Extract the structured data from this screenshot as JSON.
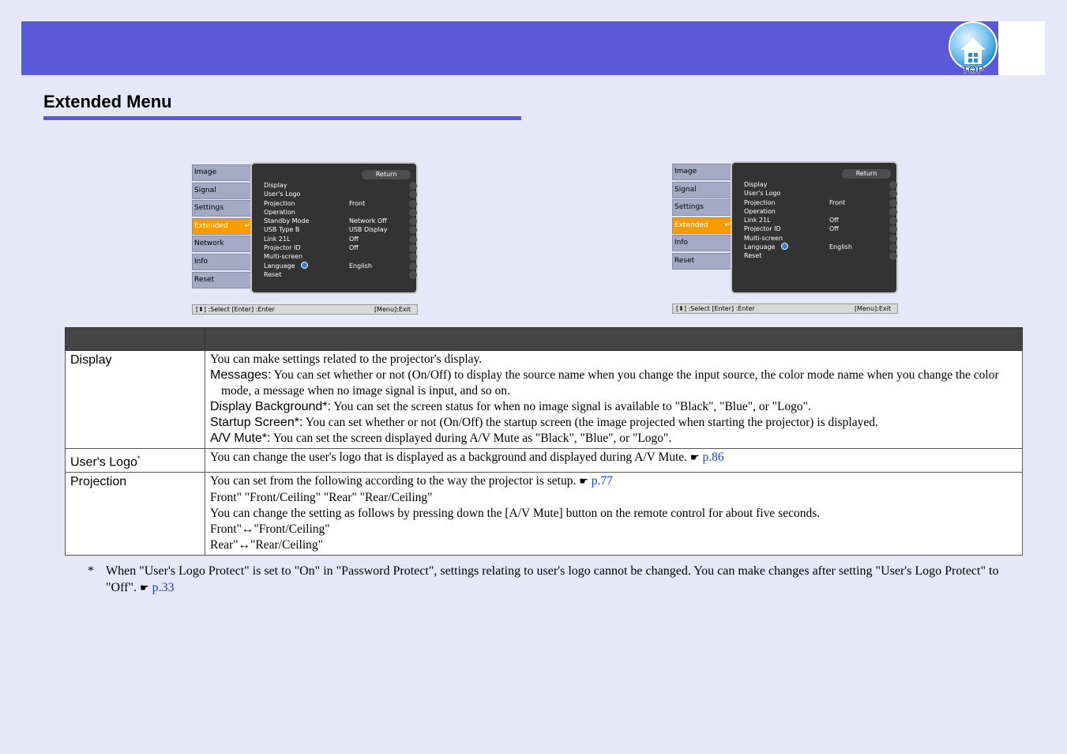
{
  "header": {
    "top_button_label": "TOP"
  },
  "page_title": "Extended Menu",
  "osd_left": {
    "tabs": [
      "Image",
      "Signal",
      "Settings",
      "Extended",
      "Network",
      "Info",
      "Reset"
    ],
    "active_tab": "Extended",
    "return_label": "Return",
    "rows": [
      {
        "label": "Display",
        "value": ""
      },
      {
        "label": "User's Logo",
        "value": ""
      },
      {
        "label": "Projection",
        "value": "Front"
      },
      {
        "label": "Operation",
        "value": ""
      },
      {
        "label": "Standby Mode",
        "value": "Network Off"
      },
      {
        "label": "USB Type B",
        "value": "USB Display"
      },
      {
        "label": "Link 21L",
        "value": "Off"
      },
      {
        "label": "Projector ID",
        "value": "Off"
      },
      {
        "label": "Multi-screen",
        "value": ""
      },
      {
        "label": "Language",
        "value": "English"
      },
      {
        "label": "Reset",
        "value": ""
      }
    ],
    "status_left": "[⬍] :Select  [Enter] :Enter",
    "status_right": "[Menu]:Exit"
  },
  "osd_right": {
    "tabs": [
      "Image",
      "Signal",
      "Settings",
      "Extended",
      "Info",
      "Reset"
    ],
    "active_tab": "Extended",
    "return_label": "Return",
    "rows": [
      {
        "label": "Display",
        "value": ""
      },
      {
        "label": "User's Logo",
        "value": ""
      },
      {
        "label": "Projection",
        "value": "Front"
      },
      {
        "label": "Operation",
        "value": ""
      },
      {
        "label": "Link 21L",
        "value": "Off"
      },
      {
        "label": "Projector ID",
        "value": "Off"
      },
      {
        "label": "Multi-screen",
        "value": ""
      },
      {
        "label": "Language",
        "value": "English"
      },
      {
        "label": "Reset",
        "value": ""
      }
    ],
    "status_left": "[⬍] :Select  [Enter] :Enter",
    "status_right": "[Menu]:Exit"
  },
  "table": {
    "display": {
      "name": "Display",
      "line1": "You can make settings related to the projector's display.",
      "messages_label": "Messages:",
      "messages_text": " You can set whether or not (On/Off) to display the source name when you change the input source, the color mode name when you change the color mode, a message when no image signal is input, and so on.",
      "background_label": "Display Background*:",
      "background_text": " You can set the screen status for when no image signal is available to \"Black\", \"Blue\", or \"Logo\".",
      "startup_label": "Startup Screen*:",
      "startup_text": " You can set whether or not (On/Off) the startup screen (the image projected when starting the projector) is displayed.",
      "avmute_label": "A/V Mute*:",
      "avmute_text": " You can set the screen displayed during A/V Mute as \"Black\", \"Blue\", or \"Logo\"."
    },
    "users_logo": {
      "name": "User's Logo",
      "sup": "*",
      "text": "You can change the user's logo that is displayed as a background and displayed during A/V Mute. ",
      "link": "p.86"
    },
    "projection": {
      "name": "Projection",
      "line1": "You can set from the following according to the way the projector is setup. ",
      "line1_link": "p.77",
      "line2": "Front\" \"Front/Ceiling\" \"Rear\" \"Rear/Ceiling\"",
      "line3": "You can change the setting as follows by pressing down the [A/V Mute] button on the remote control for about five seconds.",
      "line4_a": "Front\"",
      "line4_b": "\"Front/Ceiling\"",
      "line5_a": "Rear\"",
      "line5_b": "\"Rear/Ceiling\""
    }
  },
  "footnote": {
    "mark": "*",
    "text": "When \"User's Logo Protect\" is set to \"On\" in \"Password Protect\", settings relating to user's logo cannot be changed. You can make changes after setting \"User's Logo Protect\" to \"Off\". ",
    "link": "p.33"
  },
  "colors": {
    "header_band": "#5a5ad8",
    "active_tab": "#f59c00",
    "link": "#1a3fd0"
  }
}
